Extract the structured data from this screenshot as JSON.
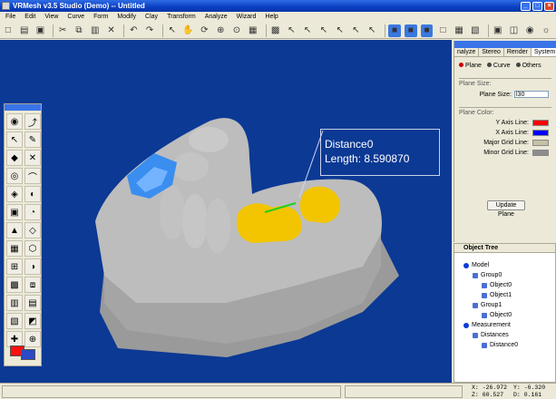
{
  "window": {
    "title": "VRMesh v3.5 Studio (Demo) -- Untitled"
  },
  "menu": [
    "File",
    "Edit",
    "View",
    "Curve",
    "Form",
    "Modify",
    "Clay",
    "Transform",
    "Analyze",
    "Wizard",
    "Help"
  ],
  "toolbar": {
    "icons": [
      "new-icon",
      "open-icon",
      "save-icon",
      "cut-icon",
      "copy-icon",
      "paste-icon",
      "delete-icon",
      "undo-icon",
      "redo-icon",
      "select-icon",
      "pan-icon",
      "rotate-icon",
      "zoom-icon",
      "zoom-fit-icon",
      "grid-icon",
      "mesh-icon",
      "pick-point-icon",
      "pick-edge-icon",
      "pick-face-icon",
      "pick-object-icon",
      "pick-region-icon",
      "pick-select-icon",
      "shade-blue-icon",
      "shade-cube-icon",
      "shade-solid-icon",
      "shade-wire-icon",
      "shade-mesh-icon",
      "shade-flat-icon",
      "view-top-icon",
      "view-iso-icon",
      "camera-icon",
      "light-icon"
    ]
  },
  "viewport": {
    "annotation": {
      "name": "Distance0",
      "length": "Length: 8.590870"
    },
    "background": "#0b3994"
  },
  "tools": {
    "count": 26
  },
  "right_panel": {
    "tabs": [
      "nalyze",
      "Stereo",
      "Render",
      "System"
    ],
    "active_tab": "System",
    "radios": [
      "Plane",
      "Curve",
      "Others"
    ],
    "plane_size_group": "Plane Size:",
    "plane_size_label": "Plane Size:",
    "plane_size_value": "l30",
    "plane_color_group": "Plane Color:",
    "colors": [
      {
        "label": "Y Axis Line:",
        "color": "#ff0000"
      },
      {
        "label": "X Axis Line:",
        "color": "#0000ff"
      },
      {
        "label": "Major Grid Line:",
        "color": "#c7c0a5"
      },
      {
        "label": "Minor Grid Line:",
        "color": "#8c8c8c"
      }
    ],
    "update_button": "Update Plane"
  },
  "object_tree": {
    "title": "Object Tree",
    "items": [
      {
        "label": "Model",
        "depth": 0
      },
      {
        "label": "Group0",
        "depth": 1
      },
      {
        "label": "Object0",
        "depth": 2
      },
      {
        "label": "Object1",
        "depth": 2
      },
      {
        "label": "Group1",
        "depth": 1
      },
      {
        "label": "Object0",
        "depth": 2
      },
      {
        "label": "Measurement",
        "depth": 0
      },
      {
        "label": "Distances",
        "depth": 1
      },
      {
        "label": "Distance0",
        "depth": 2
      }
    ]
  },
  "status": {
    "x": "X: -26.972",
    "y": "Y: -6.320",
    "z": "Z: 60.527",
    "d": "D: 0.161"
  }
}
